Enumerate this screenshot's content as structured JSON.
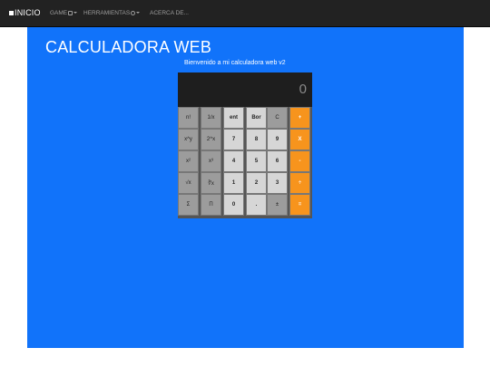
{
  "nav": {
    "brand": "INICIO",
    "items": [
      {
        "label": "GAME",
        "icon": "gamepad-icon"
      },
      {
        "label": "HERRAMIENTAS",
        "icon": "gear-icon"
      },
      {
        "label": "ACERCA DE..."
      }
    ]
  },
  "page": {
    "title": "CALCULADORA WEB",
    "subtitle": "Bienvenido a mi calculadora web v2"
  },
  "calculator": {
    "display": "0",
    "keys": [
      [
        "n!",
        "1/x",
        "ent",
        "Bor",
        "C",
        "+"
      ],
      [
        "x^y",
        "2^x",
        "7",
        "8",
        "9",
        "X"
      ],
      [
        "x²",
        "x³",
        "4",
        "5",
        "6",
        "-"
      ],
      [
        "√x",
        "∛x",
        "1",
        "2",
        "3",
        "÷"
      ],
      [
        "Σ",
        "Π",
        "0",
        ".",
        "±",
        "="
      ]
    ]
  },
  "colors": {
    "navbar": "#222222",
    "page_background": "#1173fa",
    "operator": "#f7941d",
    "display": "#1e1e1e"
  }
}
